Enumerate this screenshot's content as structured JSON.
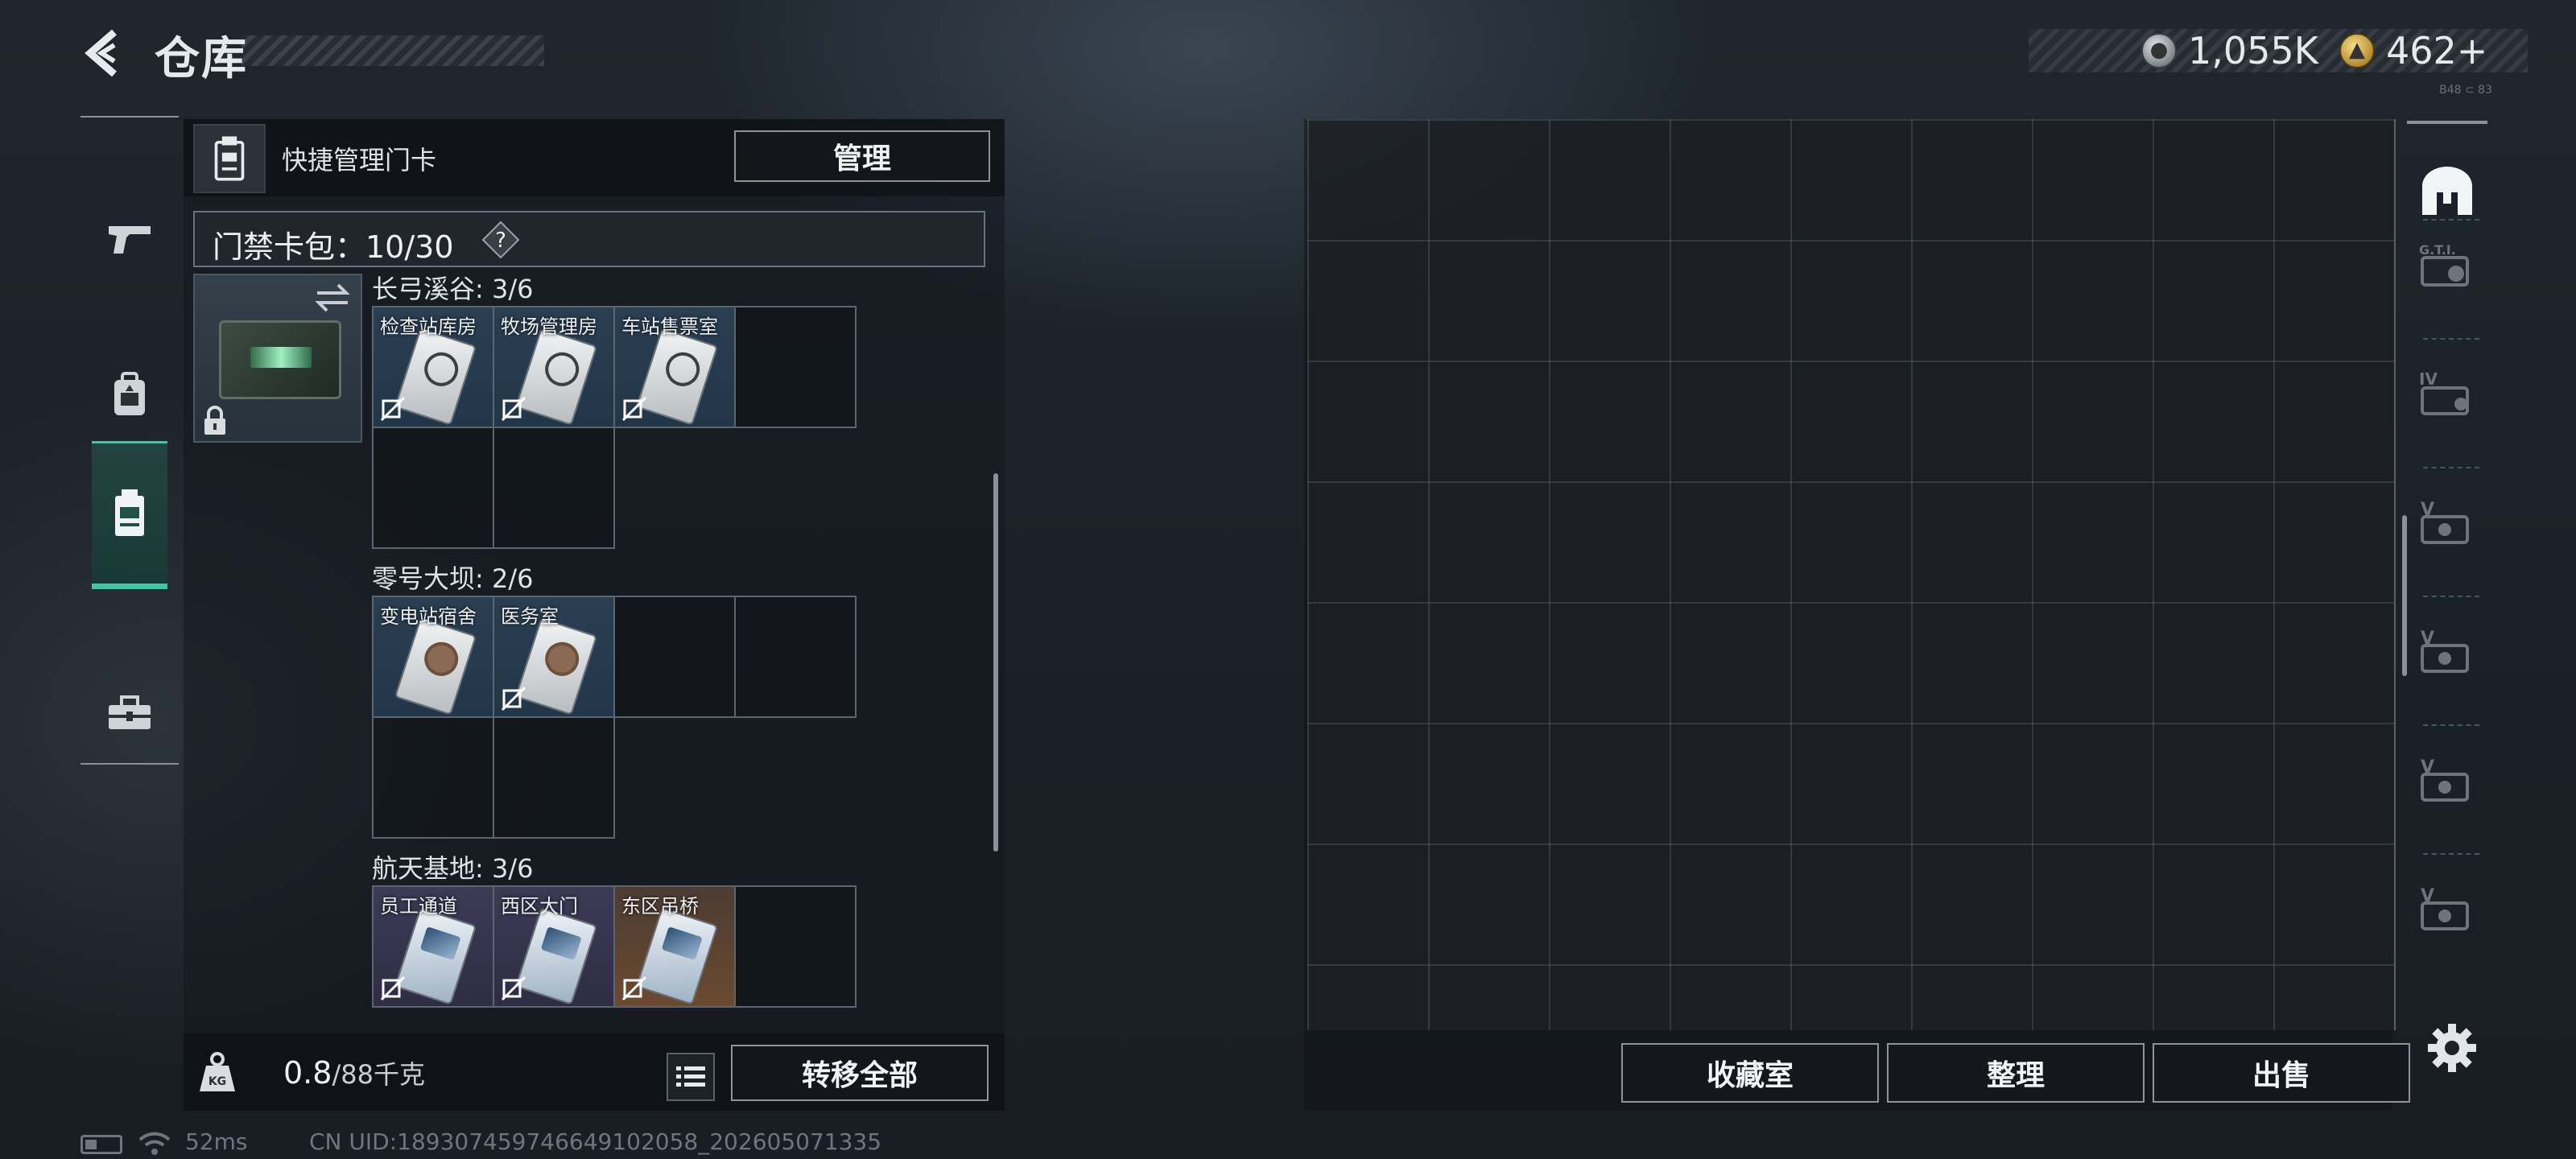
{
  "header": {
    "title": "仓库",
    "currencies": [
      {
        "icon": "silver-coin-icon",
        "value": "1,055K"
      },
      {
        "icon": "gold-coin-icon",
        "value": "462+"
      }
    ],
    "tiny_text": "B48 ⊂ 83"
  },
  "left_nav": {
    "items": [
      {
        "name": "weapons",
        "icon": "pistol-icon",
        "active": false
      },
      {
        "name": "equipment",
        "icon": "backpack-icon",
        "active": false
      },
      {
        "name": "keycards",
        "icon": "keycard-case-icon",
        "active": true
      },
      {
        "name": "supplies",
        "icon": "toolbox-icon",
        "active": false
      }
    ]
  },
  "quick_manage": {
    "label": "快捷管理门卡",
    "manage_button": "管理"
  },
  "card_pack": {
    "label": "门禁卡包：10/30",
    "help": "?"
  },
  "groups": [
    {
      "title": "长弓溪谷: 3/6",
      "cards": [
        {
          "name": "检查站库房",
          "style": "gray"
        },
        {
          "name": "牧场管理房",
          "style": "gray"
        },
        {
          "name": "车站售票室",
          "style": "gray"
        }
      ]
    },
    {
      "title": "零号大坝: 2/6",
      "cards": [
        {
          "name": "变电站宿舍",
          "style": "dark"
        },
        {
          "name": "医务室",
          "style": "dark"
        }
      ]
    },
    {
      "title": "航天基地: 3/6",
      "cards": [
        {
          "name": "员工通道",
          "style": "purple"
        },
        {
          "name": "西区大门",
          "style": "purple"
        },
        {
          "name": "东区吊桥",
          "style": "orange"
        }
      ]
    }
  ],
  "weight": {
    "current": "0.8",
    "max": "/88千克",
    "icon_text": "KG"
  },
  "actions": {
    "transfer_all": "转移全部",
    "collection_room": "收藏室",
    "organize": "整理",
    "sell": "出售"
  },
  "right_strip": {
    "items": [
      "home-icon",
      "gti-card-icon",
      "iv-card-icon",
      "v-card-icon",
      "v-card-icon",
      "v-card-icon",
      "v-card-icon"
    ]
  },
  "status": {
    "ping": "52ms",
    "uid": "CN UID:18930745974664910205​8_202605071335"
  },
  "colors": {
    "accent": "#3fc7a4",
    "item_blue": "#2b3f52",
    "item_purple": "#3c3a55",
    "item_orange": "#6b4a2f"
  }
}
